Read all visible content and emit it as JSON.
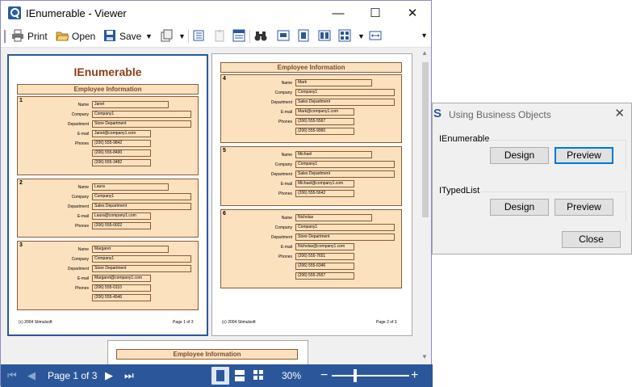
{
  "viewer": {
    "title": "IEnumerable - Viewer",
    "window_controls": {
      "minimize": "—",
      "maximize": "☐",
      "close": "✕"
    },
    "toolbar": {
      "print_label": "Print",
      "open_label": "Open",
      "save_label": "Save",
      "overflow": "▾"
    },
    "pages": [
      {
        "report_title": "IEnumerable",
        "header": "Employee Information",
        "footer_left": "(c) 2004 Stimulsoft",
        "footer_right": "Page 1 of 3",
        "records": [
          {
            "num": "1",
            "name": "Janet",
            "company": "Company1",
            "department": "Store Department",
            "email": "Janet@company1.com",
            "phones": [
              "(206) 555-9842",
              "(206) 555-8400",
              "(206) 555-3482"
            ]
          },
          {
            "num": "2",
            "name": "Laura",
            "company": "Company1",
            "department": "Sales Department",
            "email": "Laura@company1.com",
            "phones": [
              "(206) 555-0022"
            ]
          },
          {
            "num": "3",
            "name": "Margaret",
            "company": "Company1",
            "department": "Store Department",
            "email": "Margaret@company1.com",
            "phones": [
              "(206) 555-0110",
              "(206) 555-4546"
            ]
          }
        ]
      },
      {
        "header": "Employee Information",
        "footer_left": "(c) 2004 Stimulsoft",
        "footer_right": "Page 2 of 3",
        "records": [
          {
            "num": "4",
            "name": "Mark",
            "company": "Company1",
            "department": "Sales Department",
            "email": "Mark@company1.com",
            "phones": [
              "(206) 555-5567",
              "(206) 555-9960"
            ]
          },
          {
            "num": "5",
            "name": "Michael",
            "company": "Company1",
            "department": "Sales Department",
            "email": "Michael@company1.com",
            "phones": [
              "(206) 555-5642"
            ]
          },
          {
            "num": "6",
            "name": "Nicholas",
            "company": "Company1",
            "department": "Store Department",
            "email": "Nicholas@company1.com",
            "phones": [
              "(206) 555-7651",
              "(206) 555-6346",
              "(206) 555-2557"
            ]
          }
        ]
      },
      {
        "header": "Employee Information"
      }
    ],
    "field_labels": {
      "name": "Name",
      "company": "Company",
      "department": "Department",
      "email": "E-mail",
      "phones": "Phones"
    },
    "status": {
      "page_indicator": "Page 1 of 3",
      "zoom": "30%",
      "zoom_minus": "−",
      "zoom_plus": "+",
      "zoom_level_fraction": 0.3
    }
  },
  "dialog": {
    "title": "Using Business Objects",
    "close": "✕",
    "groups": [
      {
        "label": "IEnumerable",
        "design_label": "Design",
        "preview_label": "Preview"
      },
      {
        "label": "ITypedList",
        "design_label": "Design",
        "preview_label": "Preview"
      }
    ],
    "close_button_label": "Close"
  },
  "colors": {
    "accent": "#2b579a",
    "band_fill": "#fbe1be",
    "band_border": "#8a5a35",
    "title_text": "#8a3e18"
  }
}
